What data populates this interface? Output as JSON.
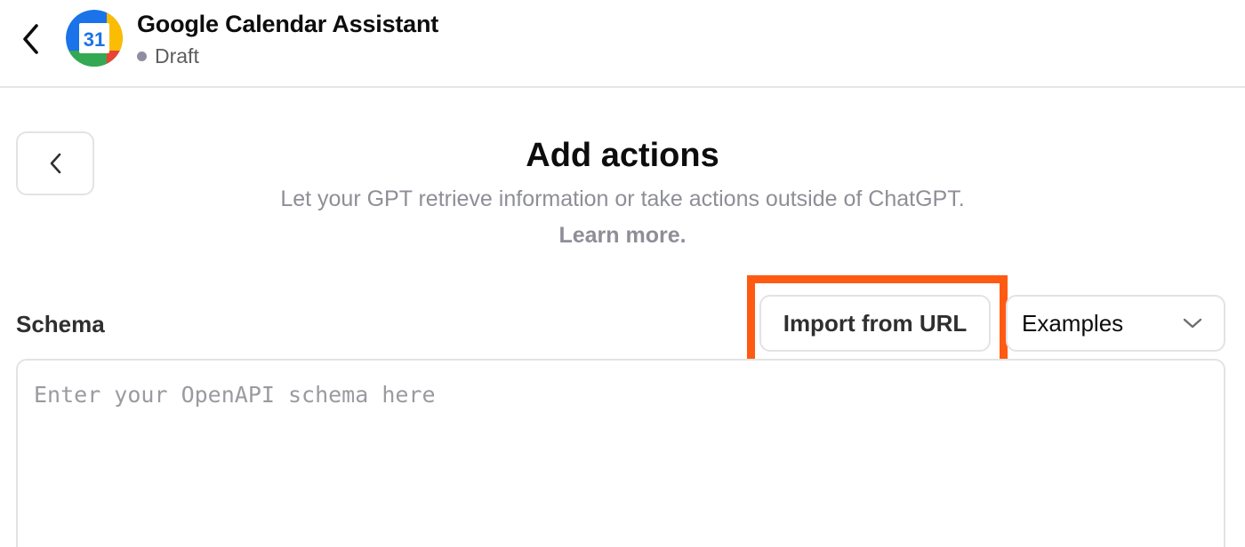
{
  "header": {
    "app_title": "Google Calendar Assistant",
    "status": "Draft",
    "app_icon": "google-calendar-icon",
    "calendar_day": "31"
  },
  "main": {
    "title": "Add actions",
    "subtitle": "Let your GPT retrieve information or take actions outside of ChatGPT.",
    "learn_more": "Learn more."
  },
  "schema": {
    "label": "Schema",
    "import_button": "Import from URL",
    "examples_selected": "Examples",
    "placeholder": "Enter your OpenAPI schema here"
  },
  "colors": {
    "highlight": "#ff5a12",
    "status_dot": "#8e8ea0",
    "border": "#e3e3e3"
  }
}
